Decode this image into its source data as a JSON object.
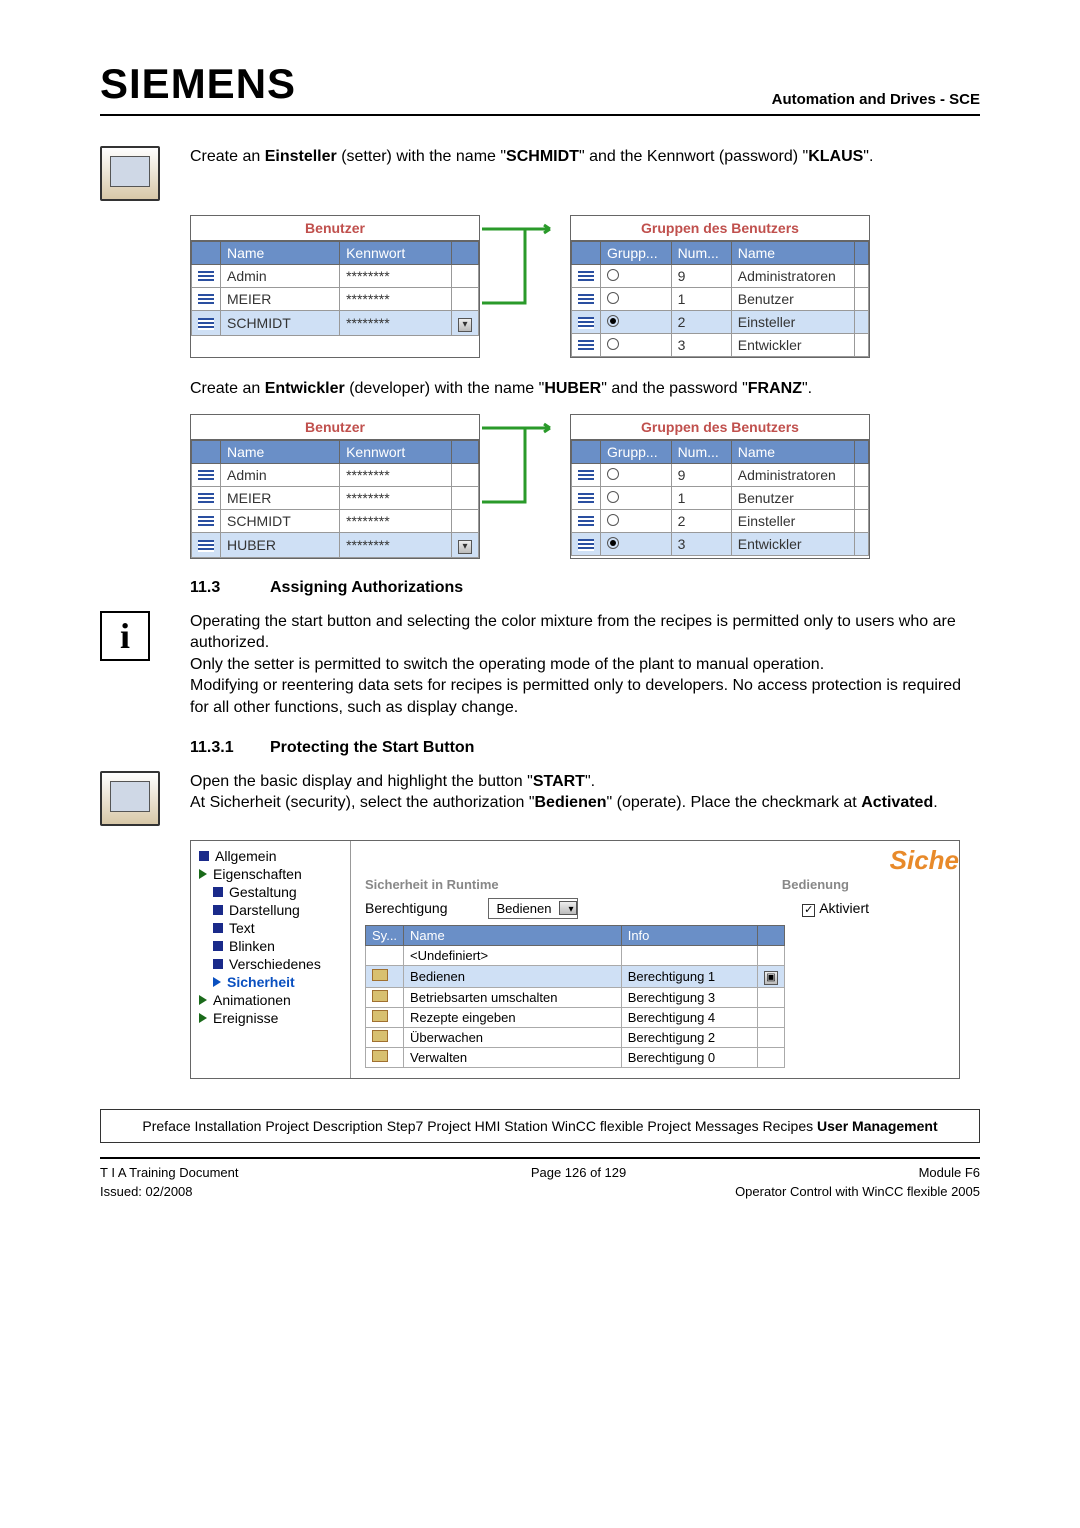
{
  "header": {
    "logo": "SIEMENS",
    "right": "Automation and Drives - SCE"
  },
  "intro1_pre": "Create an ",
  "intro1_b1": "Einsteller",
  "intro1_mid1": " (setter) with the name \"",
  "intro1_b2": "SCHMIDT",
  "intro1_mid2": "\" and the Kennwort (password) \"",
  "intro1_b3": "KLAUS",
  "intro1_end": "\".",
  "benutzer_title": "Benutzer",
  "gruppen_title": "Gruppen des Benutzers",
  "users_cols": {
    "name": "Name",
    "kennwort": "Kennwort"
  },
  "groups_cols": {
    "grupp": "Grupp...",
    "num": "Num...",
    "name": "Name"
  },
  "pw_mask": "********",
  "users1": [
    {
      "name": "Admin"
    },
    {
      "name": "MEIER"
    },
    {
      "name": "SCHMIDT",
      "sel": true
    }
  ],
  "groups1": [
    {
      "num": "9",
      "name": "Administratoren"
    },
    {
      "num": "1",
      "name": "Benutzer"
    },
    {
      "num": "2",
      "name": "Einsteller",
      "sel": true
    },
    {
      "num": "3",
      "name": "Entwickler"
    }
  ],
  "intro2_pre": "Create an ",
  "intro2_b1": "Entwickler",
  "intro2_mid1": " (developer) with the name \"",
  "intro2_b2": "HUBER",
  "intro2_mid2": "\" and the password \"",
  "intro2_b3": "FRANZ",
  "intro2_end": "\".",
  "users2": [
    {
      "name": "Admin"
    },
    {
      "name": "MEIER"
    },
    {
      "name": "SCHMIDT"
    },
    {
      "name": "HUBER",
      "sel": true
    }
  ],
  "groups2": [
    {
      "num": "9",
      "name": "Administratoren"
    },
    {
      "num": "1",
      "name": "Benutzer"
    },
    {
      "num": "2",
      "name": "Einsteller"
    },
    {
      "num": "3",
      "name": "Entwickler",
      "sel": true
    }
  ],
  "sec113_num": "11.3",
  "sec113_title": "Assigning Authorizations",
  "para113": "Operating the start button and selecting the color mixture from the recipes is permitted only to users who are authorized.\nOnly the setter is permitted to switch the operating mode of the plant to manual operation.\nModifying or reentering data sets for recipes is permitted only to developers. No access protection is required for all other functions, such as display change.",
  "sec1131_num": "11.3.1",
  "sec1131_title": "Protecting the Start Button",
  "para1131_a": "Open the basic display and highlight the button \"",
  "para1131_b1": "START",
  "para1131_b": "\".",
  "para1131_c": "At Sicherheit (security), select the authorization \"",
  "para1131_b2": "Bedienen",
  "para1131_d": "\" (operate). Place the checkmark at ",
  "para1131_b3": "Activated",
  "para1131_e": ".",
  "prop": {
    "tree": [
      "Allgemein",
      "Eigenschaften",
      "Gestaltung",
      "Darstellung",
      "Text",
      "Blinken",
      "Verschiedenes",
      "Sicherheit",
      "Animationen",
      "Ereignisse"
    ],
    "siche": "Siche",
    "grp_runtime": "Sicherheit in Runtime",
    "grp_bedienung": "Bedienung",
    "berechtigung_label": "Berechtigung",
    "berechtigung_value": "Bedienen",
    "aktiviert": "Aktiviert",
    "auth_cols": {
      "sy": "Sy...",
      "name": "Name",
      "info": "Info"
    },
    "auth_rows": [
      {
        "name": "<Undefiniert>",
        "info": ""
      },
      {
        "name": "Bedienen",
        "info": "Berechtigung 1",
        "sel": true
      },
      {
        "name": "Betriebsarten umschalten",
        "info": "Berechtigung 3"
      },
      {
        "name": "Rezepte eingeben",
        "info": "Berechtigung 4"
      },
      {
        "name": "Überwachen",
        "info": "Berechtigung 2"
      },
      {
        "name": "Verwalten",
        "info": "Berechtigung 0"
      }
    ]
  },
  "breadcrumb": "Preface Installation Project Description Step7 Project HMI Station WinCC flexible Project Messages Recipes ",
  "breadcrumb_b": "User Management",
  "footer": {
    "l1_left": "T I A  Training Document",
    "l1_center": "Page 126 of 129",
    "l1_right": "Module F6",
    "l2_left": "Issued: 02/2008",
    "l2_right": "Operator Control with WinCC flexible 2005"
  }
}
